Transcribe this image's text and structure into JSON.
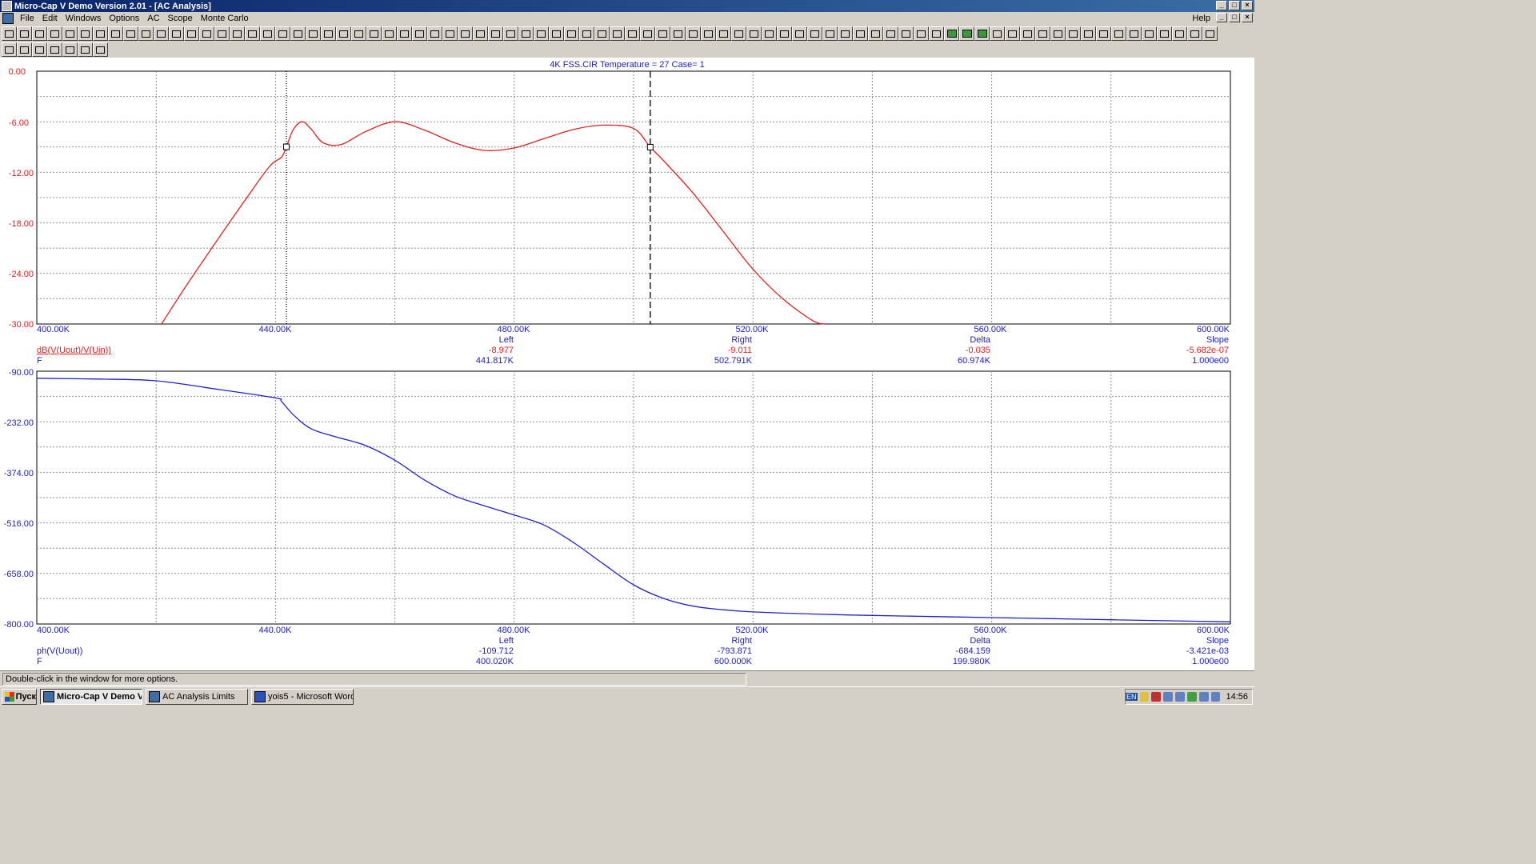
{
  "window": {
    "title": "Micro-Cap V Demo Version 2.01 - [AC Analysis]"
  },
  "menu": {
    "items": [
      "File",
      "Edit",
      "Windows",
      "Options",
      "AC",
      "Scope",
      "Monte Carlo"
    ],
    "help": "Help"
  },
  "plot": {
    "title": "4K  FSS.CIR Temperature = 27 Case= 1",
    "top": {
      "y_ticks": [
        "0.00",
        "-6.00",
        "-12.00",
        "-18.00",
        "-24.00",
        "-30.00"
      ],
      "x_ticks": [
        "400.00K",
        "440.00K",
        "480.00K",
        "520.00K",
        "560.00K",
        "600.00K"
      ],
      "expr": "dB(V(Uout)/V(Uin))",
      "xvar": "F",
      "headers": [
        "Left",
        "Right",
        "Delta",
        "Slope"
      ],
      "y_values": [
        "-8.977",
        "-9.011",
        "-0.035",
        "-5.682e-07"
      ],
      "x_values": [
        "441.817K",
        "502.791K",
        "60.974K",
        "1.000e00"
      ]
    },
    "bottom": {
      "y_ticks": [
        "-90.00",
        "-232.00",
        "-374.00",
        "-516.00",
        "-658.00",
        "-800.00"
      ],
      "x_ticks": [
        "400.00K",
        "440.00K",
        "480.00K",
        "520.00K",
        "560.00K",
        "600.00K"
      ],
      "expr": "ph(V(Uout))",
      "xvar": "F",
      "headers": [
        "Left",
        "Right",
        "Delta",
        "Slope"
      ],
      "y_values": [
        "-109.712",
        "-793.871",
        "-684.159",
        "-3.421e-03"
      ],
      "x_values": [
        "400.020K",
        "600.000K",
        "199.980K",
        "1.000e00"
      ]
    }
  },
  "chart_data": [
    {
      "type": "line",
      "xlabel": "F",
      "ylabel": "dB(V(Uout)/V(Uin))",
      "xlim": [
        400000,
        600000
      ],
      "ylim": [
        -30,
        0
      ],
      "grid": true,
      "series": [
        {
          "name": "dB(V(Uout)/V(Uin))",
          "color": "#e02020",
          "x": [
            420900,
            425000,
            430000,
            435000,
            439000,
            441000,
            441817,
            443000,
            444500,
            446000,
            448000,
            451000,
            455000,
            460000,
            465000,
            470000,
            475000,
            480000,
            485000,
            490000,
            495000,
            500000,
            502791,
            505000,
            510000,
            515000,
            520000,
            525000,
            530000,
            532000
          ],
          "y": [
            -30,
            -25.5,
            -20.3,
            -15.2,
            -11.3,
            -10.2,
            -8.98,
            -6.9,
            -6.0,
            -6.9,
            -8.5,
            -8.7,
            -7.2,
            -6.0,
            -7.0,
            -8.5,
            -9.4,
            -9.1,
            -8.0,
            -6.9,
            -6.4,
            -6.8,
            -9.01,
            -10.6,
            -14.5,
            -19.0,
            -23.5,
            -27.0,
            -29.6,
            -30
          ]
        }
      ]
    },
    {
      "type": "line",
      "xlabel": "F",
      "ylabel": "ph(V(Uout))",
      "xlim": [
        400000,
        600000
      ],
      "ylim": [
        -800,
        -90
      ],
      "grid": true,
      "series": [
        {
          "name": "ph(V(Uout))",
          "color": "#2020d0",
          "x": [
            400020,
            410000,
            420000,
            430000,
            440000,
            441000,
            443000,
            446000,
            450000,
            455000,
            460000,
            465000,
            470000,
            475000,
            480000,
            485000,
            490000,
            495000,
            500000,
            505000,
            510000,
            515000,
            520000,
            530000,
            540000,
            550000,
            560000,
            570000,
            580000,
            590000,
            600000
          ],
          "y": [
            -109.7,
            -112,
            -117,
            -140,
            -165,
            -175,
            -213,
            -252,
            -274,
            -298,
            -340,
            -396,
            -440,
            -468,
            -494,
            -522,
            -572,
            -632,
            -690,
            -728,
            -750,
            -760,
            -766,
            -772,
            -776,
            -779,
            -782,
            -785,
            -788,
            -791,
            -793.9
          ]
        }
      ]
    }
  ],
  "statusbar": {
    "text": "Double-click in the window for more options."
  },
  "taskbar": {
    "start": "Пуск",
    "tasks": [
      "Micro-Cap V Demo Ve...",
      "AC Analysis Limits",
      "yois5 - Microsoft Word"
    ],
    "lang": "EN",
    "clock": "14:56"
  },
  "colors": {
    "top_curve": "#e02020",
    "bottom_curve": "#2020d0",
    "axis_text": "#2020c0",
    "grid": "#808080"
  }
}
